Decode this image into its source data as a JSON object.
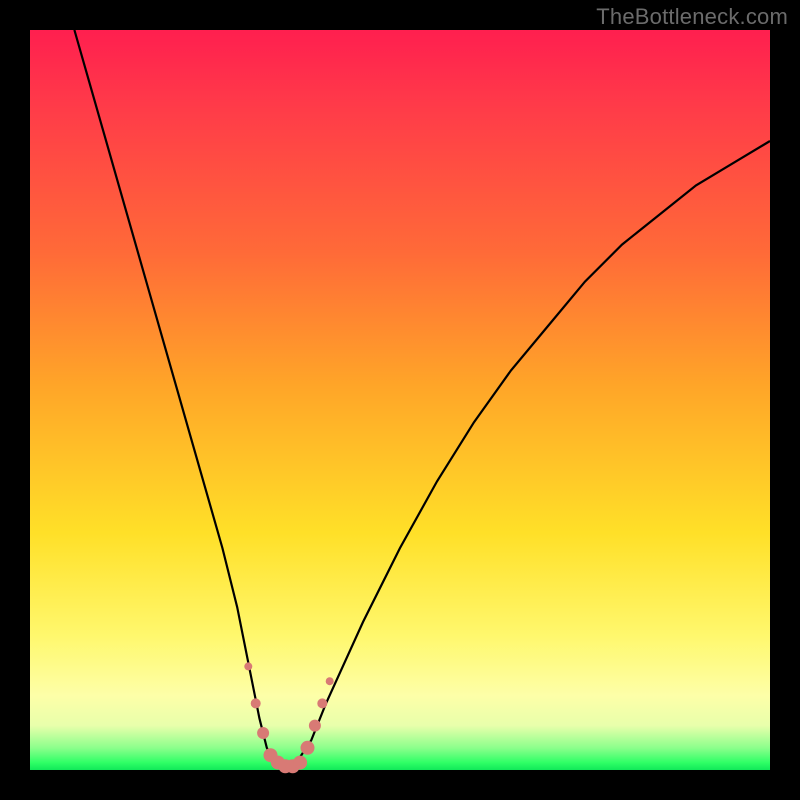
{
  "watermark": {
    "text": "TheBottleneck.com"
  },
  "chart_data": {
    "type": "line",
    "title": "",
    "xlabel": "",
    "ylabel": "",
    "xlim": [
      0,
      100
    ],
    "ylim": [
      0,
      100
    ],
    "series": [
      {
        "name": "bottleneck-curve",
        "x": [
          6,
          8,
          10,
          12,
          14,
          16,
          18,
          20,
          22,
          24,
          26,
          28,
          30,
          31,
          32,
          33,
          34,
          35,
          36,
          38,
          40,
          45,
          50,
          55,
          60,
          65,
          70,
          75,
          80,
          85,
          90,
          95,
          100
        ],
        "values": [
          100,
          93,
          86,
          79,
          72,
          65,
          58,
          51,
          44,
          37,
          30,
          22,
          12,
          7,
          3,
          1,
          0,
          0,
          1,
          4,
          9,
          20,
          30,
          39,
          47,
          54,
          60,
          66,
          71,
          75,
          79,
          82,
          85
        ]
      }
    ],
    "highlight": {
      "name": "bottom-dots",
      "color": "#d87a75",
      "points": [
        {
          "x": 29.5,
          "y": 14,
          "r": 4
        },
        {
          "x": 30.5,
          "y": 9,
          "r": 5
        },
        {
          "x": 31.5,
          "y": 5,
          "r": 6
        },
        {
          "x": 32.5,
          "y": 2,
          "r": 7
        },
        {
          "x": 33.5,
          "y": 1,
          "r": 7
        },
        {
          "x": 34.5,
          "y": 0.5,
          "r": 7
        },
        {
          "x": 35.5,
          "y": 0.5,
          "r": 7
        },
        {
          "x": 36.5,
          "y": 1,
          "r": 7
        },
        {
          "x": 37.5,
          "y": 3,
          "r": 7
        },
        {
          "x": 38.5,
          "y": 6,
          "r": 6
        },
        {
          "x": 39.5,
          "y": 9,
          "r": 5
        },
        {
          "x": 40.5,
          "y": 12,
          "r": 4
        }
      ]
    }
  }
}
